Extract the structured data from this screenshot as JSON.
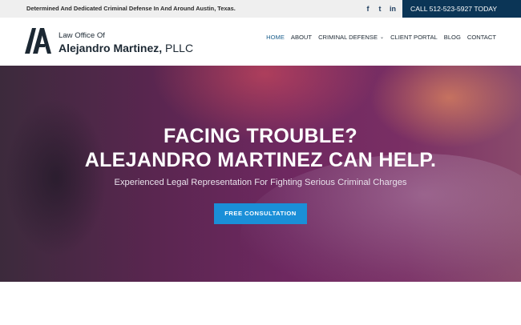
{
  "topbar": {
    "tagline": "Determined And Dedicated Criminal Defense In And Around Austin, Texas.",
    "social": [
      {
        "icon": "facebook-icon",
        "glyph": "f"
      },
      {
        "icon": "twitter-icon",
        "glyph": "t"
      },
      {
        "icon": "linkedin-icon",
        "glyph": "in"
      }
    ],
    "call_label": "CALL 512-523-5927 TODAY"
  },
  "header": {
    "logo_line1": "Law Office Of",
    "logo_name": "Alejandro Martinez,",
    "logo_suffix": " PLLC",
    "nav": [
      "HOME",
      "ABOUT",
      "CRIMINAL DEFENSE",
      "CLIENT PORTAL",
      "BLOG",
      "CONTACT"
    ],
    "dropdown_glyph": "⌄"
  },
  "hero": {
    "headline_line1": "FACING TROUBLE?",
    "headline_line2": "ALEJANDRO MARTINEZ CAN HELP.",
    "subheading": "Experienced Legal Representation For Fighting Serious Criminal Charges",
    "cta_label": "FREE CONSULTATION"
  },
  "colors": {
    "brand_navy": "#0b3556",
    "cta_blue": "#1a8fd8",
    "nav_active": "#1b5f8c",
    "topbar_bg": "#efefef"
  }
}
